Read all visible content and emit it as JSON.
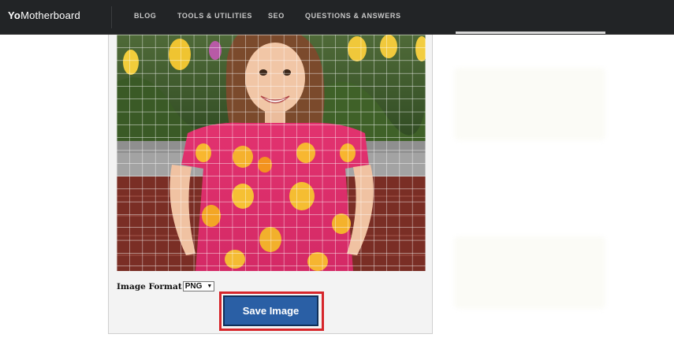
{
  "header": {
    "logo_prefix": "Yo",
    "logo_rest": "Motherboard",
    "nav": [
      "BLOG",
      "TOOLS & UTILITIES",
      "SEO",
      "QUESTIONS & ANSWERS"
    ]
  },
  "editor": {
    "image_format_label": "Image Format",
    "image_format_value": "PNG",
    "save_button_label": "Save Image"
  },
  "colors": {
    "topbar": "#222426",
    "save_button": "#2a5fa5",
    "highlight": "#d6262b"
  }
}
